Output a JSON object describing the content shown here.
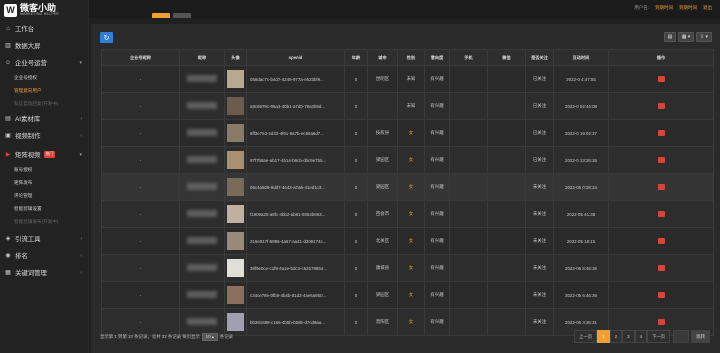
{
  "brand": {
    "name": "微客小助",
    "sub": "MARKETING HELPER"
  },
  "nav": [
    {
      "icon": "home-icon",
      "glyph": "⌂",
      "label": "工作台"
    },
    {
      "icon": "chart-icon",
      "glyph": "▥",
      "label": "数据大屏"
    },
    {
      "icon": "user-icon",
      "glyph": "☺",
      "label": "企业号运营",
      "arrow": "▾"
    }
  ],
  "sub1": [
    {
      "label": "企业号授权",
      "state": ""
    },
    {
      "label": "管理意向用户",
      "state": "active"
    },
    {
      "label": "私信自动回复(开发中)",
      "state": "dim"
    }
  ],
  "nav2": [
    {
      "icon": "ai-icon",
      "glyph": "▤",
      "label": "AI素材库",
      "arrow": "‹"
    },
    {
      "icon": "video-icon",
      "glyph": "▣",
      "label": "视频制作",
      "arrow": "‹"
    }
  ],
  "nav3": {
    "icon": "cast-icon",
    "glyph": "▶",
    "label": "矩阵视频",
    "badge": "热门",
    "arrow": "▾"
  },
  "sub2": [
    {
      "label": "账号授权",
      "state": ""
    },
    {
      "label": "矩阵发布",
      "state": ""
    },
    {
      "label": "评论管理",
      "state": ""
    },
    {
      "label": "智能剪辑设置",
      "state": ""
    },
    {
      "label": "智能剪辑发布(开发中)",
      "state": "dim"
    }
  ],
  "nav4": [
    {
      "icon": "flow-icon",
      "glyph": "◈",
      "label": "引流工具",
      "arrow": "‹"
    },
    {
      "icon": "rank-icon",
      "glyph": "◉",
      "label": "排名",
      "arrow": "‹"
    },
    {
      "icon": "keyword-icon",
      "glyph": "▦",
      "label": "关键词管理",
      "arrow": "‹"
    }
  ],
  "topbar": {
    "user_label": "用户名:",
    "vip_label": "到期时间",
    "expire_label": "到期时间",
    "logout": "退出"
  },
  "toolbar": {
    "refresh": "↻",
    "t1": "▤",
    "t2": "▦ ▾",
    "t3": "⇩ ▾"
  },
  "table": {
    "headers": [
      "企业号昵称",
      "昵称",
      "头像",
      "openid",
      "年龄",
      "城市",
      "性别",
      "意向度",
      "手机",
      "微信",
      "是否关注",
      "互动时间",
      "操作"
    ],
    "rows": [
      {
        "ent": "-",
        "openid": "058dac7c-b4d7-4249-977a-e523bf9...",
        "age": "0",
        "city": "昆明区",
        "gender": "未知",
        "g": "u",
        "intent": "有兴趣",
        "phone": "",
        "wx": "",
        "follow": "已关注",
        "f": "y",
        "time": "2022-0      4:47:55"
      },
      {
        "ent": "-",
        "openid": "a8c6979c-95a3-40b1-a7d0-79a3b9d...",
        "age": "0",
        "city": "",
        "gender": "未知",
        "g": "u",
        "intent": "有兴趣",
        "phone": "",
        "wx": "",
        "follow": "已关注",
        "f": "y",
        "time": "2022-0      02:44:08"
      },
      {
        "ent": "-",
        "openid": "8ff3e753-2d33-4f61-8a7b-ec65a6d7...",
        "age": "0",
        "city": "技权县",
        "gender": "女",
        "g": "m",
        "intent": "有兴趣",
        "phone": "",
        "wx": "",
        "follow": "已关注",
        "f": "y",
        "time": "2022-0      19:02:37"
      },
      {
        "ent": "-",
        "openid": "97f7b8ae-ab17-4b14-b9cb-dbc9e7b5...",
        "age": "0",
        "city": "梁园区",
        "gender": "女",
        "g": "m",
        "intent": "有兴趣",
        "phone": "",
        "wx": "",
        "follow": "已关注",
        "f": "y",
        "time": "2022-0      13:26:36"
      },
      {
        "ent": "-",
        "openid": "06c4a509-9dd7-4e43-a7a6-41ed1c3...",
        "age": "0",
        "city": "梁园区",
        "gender": "女",
        "g": "m",
        "intent": "有兴趣",
        "phone": "",
        "wx": "",
        "follow": "未关注",
        "f": "n",
        "time": "2022-05      0:28:24"
      },
      {
        "ent": "-",
        "openid": "f1909a26-a8fc-4bb2-ab91-6954b693...",
        "age": "0",
        "city": "西会市",
        "gender": "女",
        "g": "m",
        "intent": "有兴趣",
        "phone": "",
        "wx": "",
        "follow": "未关注",
        "f": "n",
        "time": "2022-05      41:38"
      },
      {
        "ent": "-",
        "openid": "219e917f-5896-4a67-aa41-d209174c...",
        "age": "0",
        "city": "北关区",
        "gender": "女",
        "g": "m",
        "intent": "有兴趣",
        "phone": "",
        "wx": "",
        "follow": "未关注",
        "f": "n",
        "time": "2022-05      18:15"
      },
      {
        "ent": "-",
        "openid": "38f9e0ce-c1f8-4a1e-bdc3-c62b78854...",
        "age": "0",
        "city": "康城县",
        "gender": "女",
        "g": "m",
        "intent": "有兴趣",
        "phone": "",
        "wx": "",
        "follow": "未关注",
        "f": "n",
        "time": "2022-05      8:48:36"
      },
      {
        "ent": "-",
        "openid": "c34ce78e-0fb9-4b4b-81d2-4ae6a950...",
        "age": "0",
        "city": "梁园区",
        "gender": "女",
        "g": "m",
        "intent": "有兴趣",
        "phone": "",
        "wx": "",
        "follow": "未关注",
        "f": "n",
        "time": "2022-05      6:46:36"
      },
      {
        "ent": "-",
        "openid": "bb381688-c166-4b5b-b58b-d7cd8aa...",
        "age": "0",
        "city": "晋阳区",
        "gender": "女",
        "g": "m",
        "intent": "有兴趣",
        "phone": "",
        "wx": "",
        "follow": "未关注",
        "f": "n",
        "time": "2022-05      3:35:31"
      }
    ]
  },
  "footer": {
    "pre": "显示第 1 到第 10 条记录，总共 33 条记录 每页显示",
    "page_size": "10 ▴",
    "post": "条记录"
  },
  "pager": {
    "prev": "上一页",
    "pages": [
      "1",
      "2",
      "3",
      "4"
    ],
    "next": "下一页",
    "go": "跳转"
  }
}
